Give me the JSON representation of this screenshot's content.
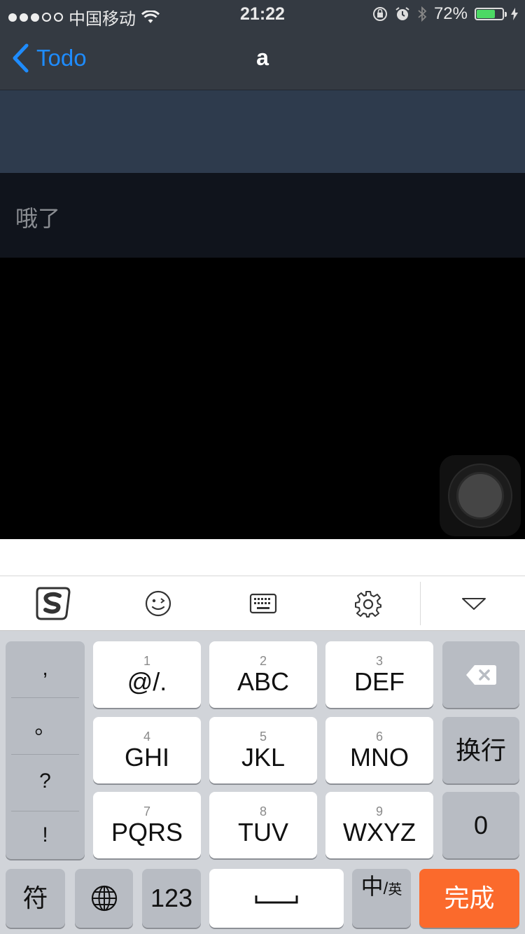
{
  "status_bar": {
    "carrier": "中国移动",
    "time": "21:22",
    "battery_percent": "72%",
    "battery_level": 0.72
  },
  "nav": {
    "back_label": "Todo",
    "title": "a"
  },
  "content": {
    "todo_item": "哦了"
  },
  "keyboard": {
    "punctuation": [
      ",",
      "。",
      "?",
      "!"
    ],
    "rows": [
      [
        {
          "num": "1",
          "label": "@/."
        },
        {
          "num": "2",
          "label": "ABC"
        },
        {
          "num": "3",
          "label": "DEF"
        }
      ],
      [
        {
          "num": "4",
          "label": "GHI"
        },
        {
          "num": "5",
          "label": "JKL"
        },
        {
          "num": "6",
          "label": "MNO"
        }
      ],
      [
        {
          "num": "7",
          "label": "PQRS"
        },
        {
          "num": "8",
          "label": "TUV"
        },
        {
          "num": "9",
          "label": "WXYZ"
        }
      ]
    ],
    "return_label": "换行",
    "zero_label": "0",
    "symbol_label": "符",
    "numbers_label": "123",
    "lang_main": "中",
    "lang_sub": "英",
    "done_label": "完成",
    "done_color": "#fb6a2c"
  }
}
